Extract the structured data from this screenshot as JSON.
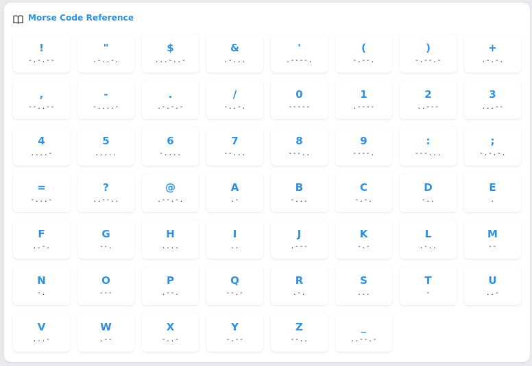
{
  "header": {
    "title": "Morse Code Reference",
    "icon": "book-icon"
  },
  "colors": {
    "accent": "#2f8fe0",
    "code_text": "#3b3f45"
  },
  "entries": [
    {
      "char": "!",
      "code": "-.-.--"
    },
    {
      "char": "\"",
      "code": ".-..-."
    },
    {
      "char": "$",
      "code": "...-..-"
    },
    {
      "char": "&",
      "code": ".-..."
    },
    {
      "char": "'",
      "code": ".----."
    },
    {
      "char": "(",
      "code": "-.--."
    },
    {
      "char": ")",
      "code": "-.--.-"
    },
    {
      "char": "+",
      "code": ".-.-."
    },
    {
      "char": ",",
      "code": "--..--"
    },
    {
      "char": "-",
      "code": "-....-"
    },
    {
      "char": ".",
      "code": ".-.-.-"
    },
    {
      "char": "/",
      "code": "-..-."
    },
    {
      "char": "0",
      "code": "-----"
    },
    {
      "char": "1",
      "code": ".----"
    },
    {
      "char": "2",
      "code": "..---"
    },
    {
      "char": "3",
      "code": "...--"
    },
    {
      "char": "4",
      "code": "....-"
    },
    {
      "char": "5",
      "code": "....."
    },
    {
      "char": "6",
      "code": "-...."
    },
    {
      "char": "7",
      "code": "--..."
    },
    {
      "char": "8",
      "code": "---.."
    },
    {
      "char": "9",
      "code": "----."
    },
    {
      "char": ":",
      "code": "---..."
    },
    {
      "char": ";",
      "code": "-.-.-."
    },
    {
      "char": "=",
      "code": "-...-"
    },
    {
      "char": "?",
      "code": "..--.."
    },
    {
      "char": "@",
      "code": ".--.-."
    },
    {
      "char": "A",
      "code": ".-"
    },
    {
      "char": "B",
      "code": "-..."
    },
    {
      "char": "C",
      "code": "-.-."
    },
    {
      "char": "D",
      "code": "-.."
    },
    {
      "char": "E",
      "code": "."
    },
    {
      "char": "F",
      "code": "..-."
    },
    {
      "char": "G",
      "code": "--."
    },
    {
      "char": "H",
      "code": "...."
    },
    {
      "char": "I",
      "code": ".."
    },
    {
      "char": "J",
      "code": ".---"
    },
    {
      "char": "K",
      "code": "-.-"
    },
    {
      "char": "L",
      "code": ".-.."
    },
    {
      "char": "M",
      "code": "--"
    },
    {
      "char": "N",
      "code": "-."
    },
    {
      "char": "O",
      "code": "---"
    },
    {
      "char": "P",
      "code": ".--."
    },
    {
      "char": "Q",
      "code": "--.-"
    },
    {
      "char": "R",
      "code": ".-."
    },
    {
      "char": "S",
      "code": "..."
    },
    {
      "char": "T",
      "code": "-"
    },
    {
      "char": "U",
      "code": "..-"
    },
    {
      "char": "V",
      "code": "...-"
    },
    {
      "char": "W",
      "code": ".--"
    },
    {
      "char": "X",
      "code": "-..-"
    },
    {
      "char": "Y",
      "code": "-.--"
    },
    {
      "char": "Z",
      "code": "--.."
    },
    {
      "char": "_",
      "code": "..--.-"
    }
  ]
}
